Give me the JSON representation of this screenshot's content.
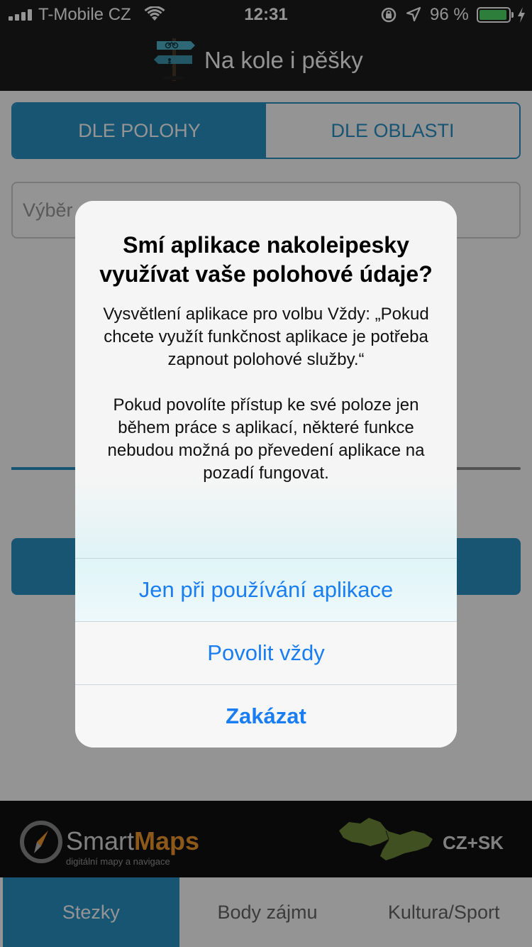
{
  "status_bar": {
    "carrier": "T-Mobile CZ",
    "time": "12:31",
    "battery_percent": "96 %",
    "battery_level": 0.96
  },
  "header": {
    "title": "Na kole i pěšky",
    "logo_icon": "signpost-icon"
  },
  "segments": {
    "by_location": "DLE POLOHY",
    "by_area": "DLE OBLASTI"
  },
  "select": {
    "placeholder": "Výběr"
  },
  "alert": {
    "title": "Smí aplikace nakoleipesky využívat vaše polohové údaje?",
    "message_1": "Vysvětlení aplikace pro volbu Vždy: „Pokud chcete využít funkčnost aplikace je potřeba zapnout polohové služby.“",
    "message_2": "Pokud povolíte přístup ke své poloze jen během práce s aplikací, některé funkce nebudou možná po převedení aplikace na pozadí fungovat.",
    "button_while_using": "Jen při používání aplikace",
    "button_always": "Povolit vždy",
    "button_deny": "Zakázat"
  },
  "banner": {
    "brand_part1": "Smart",
    "brand_part2": "Maps",
    "tagline": "digitální mapy a navigace",
    "region": "CZ+SK"
  },
  "tabs": [
    "Stezky",
    "Body zájmu",
    "Kultura/Sport"
  ],
  "colors": {
    "accent": "#2a93c6",
    "ios_link": "#1a7ef2",
    "brand_orange": "#f29a2e",
    "map_green": "#6f8a3a"
  }
}
